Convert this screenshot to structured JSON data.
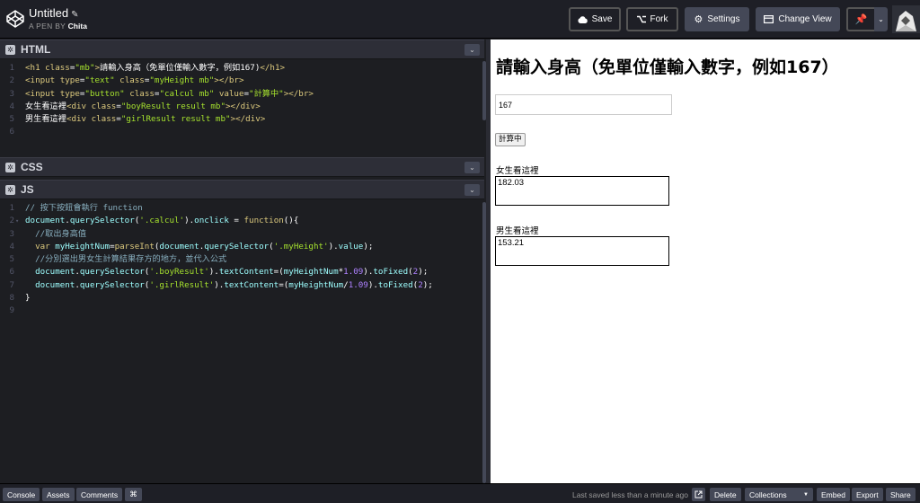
{
  "header": {
    "title": "Untitled",
    "author_prefix": "A PEN BY",
    "author": "Chita",
    "save_label": "Save",
    "fork_label": "Fork",
    "settings_label": "Settings",
    "change_view_label": "Change View"
  },
  "editors": {
    "html": {
      "title": "HTML",
      "line_numbers": [
        "1",
        "2",
        "3",
        "4",
        "5",
        "6"
      ]
    },
    "css": {
      "title": "CSS"
    },
    "js": {
      "title": "JS",
      "line_numbers": [
        "1",
        "2",
        "3",
        "4",
        "5",
        "6",
        "7",
        "8",
        "9"
      ]
    }
  },
  "preview": {
    "heading": "請輸入身高（免單位僅輸入數字，例如167）",
    "input_value": "167",
    "button_value": "計算中",
    "girl_label": "女生看這裡",
    "girl_result": "182.03",
    "boy_label": "男生看這裡",
    "boy_result": "153.21"
  },
  "footer": {
    "console": "Console",
    "assets": "Assets",
    "comments": "Comments",
    "shortcuts": "⌘",
    "saved_text": "Last saved less than a minute ago",
    "delete": "Delete",
    "collections": "Collections",
    "embed": "Embed",
    "export": "Export",
    "share": "Share"
  },
  "colors": {
    "bg": "#1e1f26",
    "editor_bg": "#1d1e22",
    "button_grey": "#444857",
    "syntax_yellow": "#ddca7e",
    "syntax_green": "#a6e22e",
    "syntax_cyan": "#9effff",
    "syntax_comment": "#88afbf",
    "syntax_number": "#ae81ff"
  }
}
